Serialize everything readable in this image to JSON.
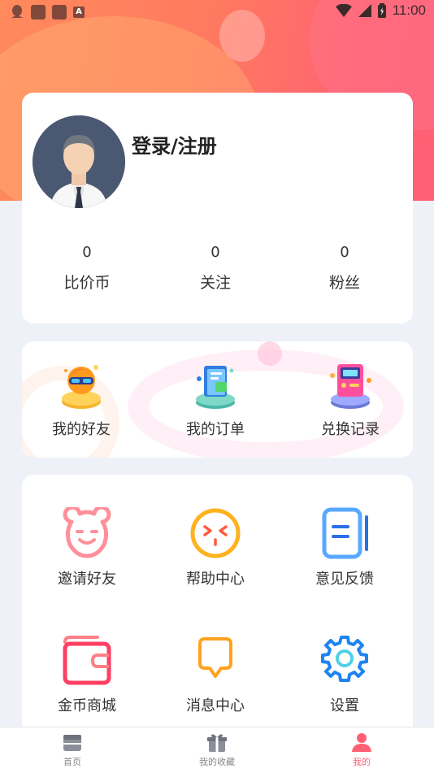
{
  "status_bar": {
    "time": "11:00",
    "icons": [
      "qq-icon",
      "app-icon",
      "app-icon",
      "a-icon",
      "wifi-icon",
      "signal-icon",
      "battery-icon"
    ]
  },
  "profile": {
    "login_label": "登录/注册"
  },
  "stats": [
    {
      "value": "0",
      "label": "比价币"
    },
    {
      "value": "0",
      "label": "关注"
    },
    {
      "value": "0",
      "label": "粉丝"
    }
  ],
  "quick_actions": [
    {
      "label": "我的好友",
      "icon": "friends-icon"
    },
    {
      "label": "我的订单",
      "icon": "orders-icon"
    },
    {
      "label": "兑换记录",
      "icon": "exchange-record-icon"
    }
  ],
  "menu": [
    {
      "label": "邀请好友",
      "icon": "bear-face-icon"
    },
    {
      "label": "帮助中心",
      "icon": "help-face-icon"
    },
    {
      "label": "意见反馈",
      "icon": "feedback-icon"
    },
    {
      "label": "金币商城",
      "icon": "wallet-icon"
    },
    {
      "label": "消息中心",
      "icon": "message-icon"
    },
    {
      "label": "设置",
      "icon": "settings-gear-icon"
    }
  ],
  "tabs": [
    {
      "label": "首页",
      "icon": "home-icon",
      "active": false
    },
    {
      "label": "我的收藏",
      "icon": "gift-icon",
      "active": false
    },
    {
      "label": "我的",
      "icon": "user-icon",
      "active": true
    }
  ],
  "colors": {
    "accent": "#ff5f74",
    "hero_start": "#ff8a5c",
    "hero_end": "#ff5f74",
    "background": "#eef1f8"
  }
}
